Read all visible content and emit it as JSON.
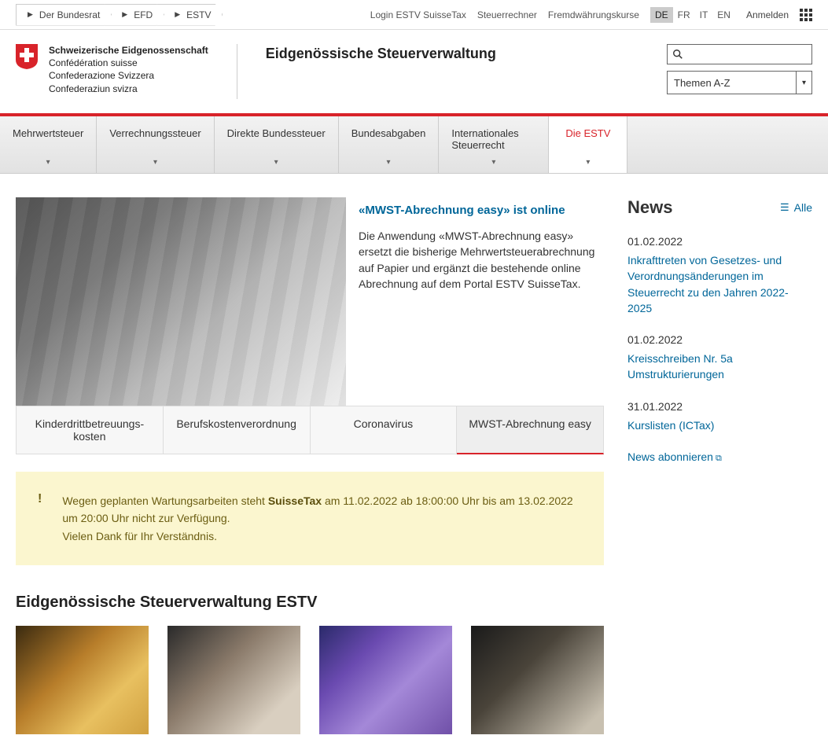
{
  "breadcrumb": [
    "Der Bundesrat",
    "EFD",
    "ESTV"
  ],
  "util_links": [
    "Login ESTV SuisseTax",
    "Steuerrechner",
    "Fremdwährungskurse"
  ],
  "langs": [
    "DE",
    "FR",
    "IT",
    "EN"
  ],
  "active_lang": "DE",
  "login_label": "Anmelden",
  "logo_lines": [
    "Schweizerische Eidgenossenschaft",
    "Confédération suisse",
    "Confederazione Svizzera",
    "Confederaziun svizra"
  ],
  "site_title": "Eidgenössische Steuerverwaltung",
  "themes_label": "Themen A-Z",
  "nav": [
    {
      "label": "Mehrwertsteuer"
    },
    {
      "label": "Verrechnungssteuer"
    },
    {
      "label": "Direkte Bundessteuer"
    },
    {
      "label": "Bundesabgaben"
    },
    {
      "label": "Internationales Steuerrecht",
      "wide": true
    },
    {
      "label": "Die ESTV",
      "active": true
    }
  ],
  "feature": {
    "title": "«MWST-Abrechnung easy» ist online",
    "body": "Die Anwendung «MWST-Abrechnung easy» ersetzt die bisherige Mehrwertsteuerabrechnung auf Papier und ergänzt die bestehende online Abrechnung auf dem Portal ESTV SuisseTax."
  },
  "feature_tabs": [
    {
      "label": "Kinderdrittbetreuungs-\nkosten"
    },
    {
      "label": "Berufskostenverordnung"
    },
    {
      "label": "Coronavirus"
    },
    {
      "label": "MWST-Abrechnung easy",
      "active": true
    }
  ],
  "alert": {
    "l1a": "Wegen geplanten Wartungsarbeiten steht ",
    "l1b": "SuisseTax",
    "l1c": " am 11.02.2022 ab 18:00:00 Uhr bis am 13.02.2022",
    "l2": "um 20:00 Uhr nicht zur Verfügung.",
    "l3": "Vielen Dank für Ihr Verständnis."
  },
  "section_heading": "Eidgenössische Steuerverwaltung ESTV",
  "news_heading": "News",
  "news_all": "Alle",
  "news": [
    {
      "date": "01.02.2022",
      "title": "Inkrafttreten von Gesetzes- und Verordnungsänderungen im Steuerrecht zu den Jahren 2022-2025"
    },
    {
      "date": "01.02.2022",
      "title": "Kreisschreiben Nr. 5a Umstrukturierungen"
    },
    {
      "date": "31.01.2022",
      "title": "Kurslisten (ICTax)"
    }
  ],
  "news_subscribe": "News abonnieren"
}
